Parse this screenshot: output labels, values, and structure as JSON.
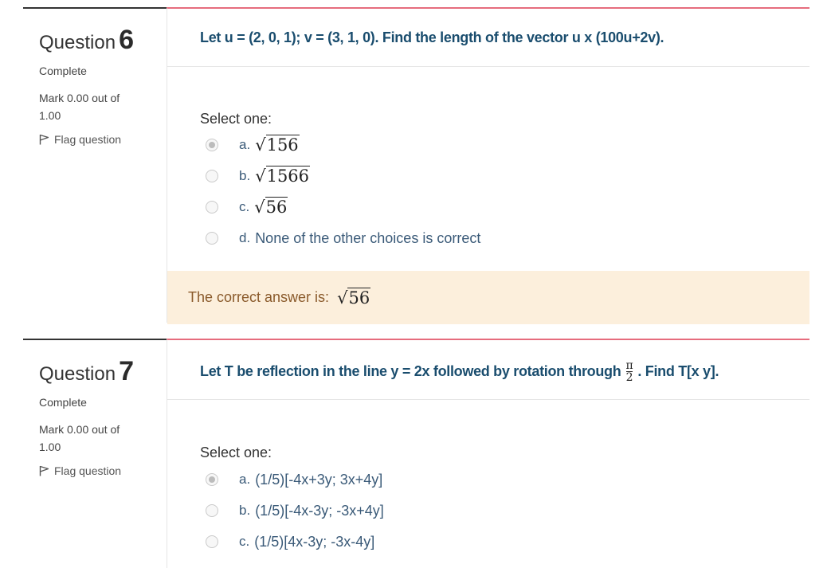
{
  "questions": [
    {
      "label": "Question",
      "number": "6",
      "state": "Complete",
      "mark": "Mark 0.00 out of 1.00",
      "flag_label": "Flag question",
      "text": "Let u = (2, 0, 1); v = (3, 1, 0). Find the length of the vector u x (100u+2v).",
      "prompt": "Select one:",
      "options": [
        {
          "letter": "a.",
          "radical": "156",
          "selected": true
        },
        {
          "letter": "b.",
          "radical": "1566",
          "selected": false
        },
        {
          "letter": "c.",
          "radical": "56",
          "selected": false
        },
        {
          "letter": "d.",
          "text": "None of the other choices is correct",
          "selected": false
        }
      ],
      "feedback_label": "The correct answer is:",
      "feedback_radical": "56"
    },
    {
      "label": "Question",
      "number": "7",
      "state": "Complete",
      "mark": "Mark 0.00 out of 1.00",
      "flag_label": "Flag question",
      "text_before": "Let T be reflection in the line y = 2x followed by rotation through",
      "frac_num": "π",
      "frac_den": "2",
      "text_after": ". Find T[x y].",
      "prompt": "Select one:",
      "options": [
        {
          "letter": "a.",
          "text": "(1/5)[-4x+3y; 3x+4y]",
          "selected": true
        },
        {
          "letter": "b.",
          "text": "(1/5)[-4x-3y; -3x+4y]",
          "selected": false
        },
        {
          "letter": "c.",
          "text": "(1/5)[4x-3y; -3x-4y]",
          "selected": false
        }
      ]
    }
  ],
  "colors": {
    "accent_rule": "#e66c7d",
    "question_text": "#1a4d6e",
    "feedback_bg": "#fcefdc"
  },
  "icons": {
    "flag": "flag-icon",
    "radio": "radio-button"
  }
}
